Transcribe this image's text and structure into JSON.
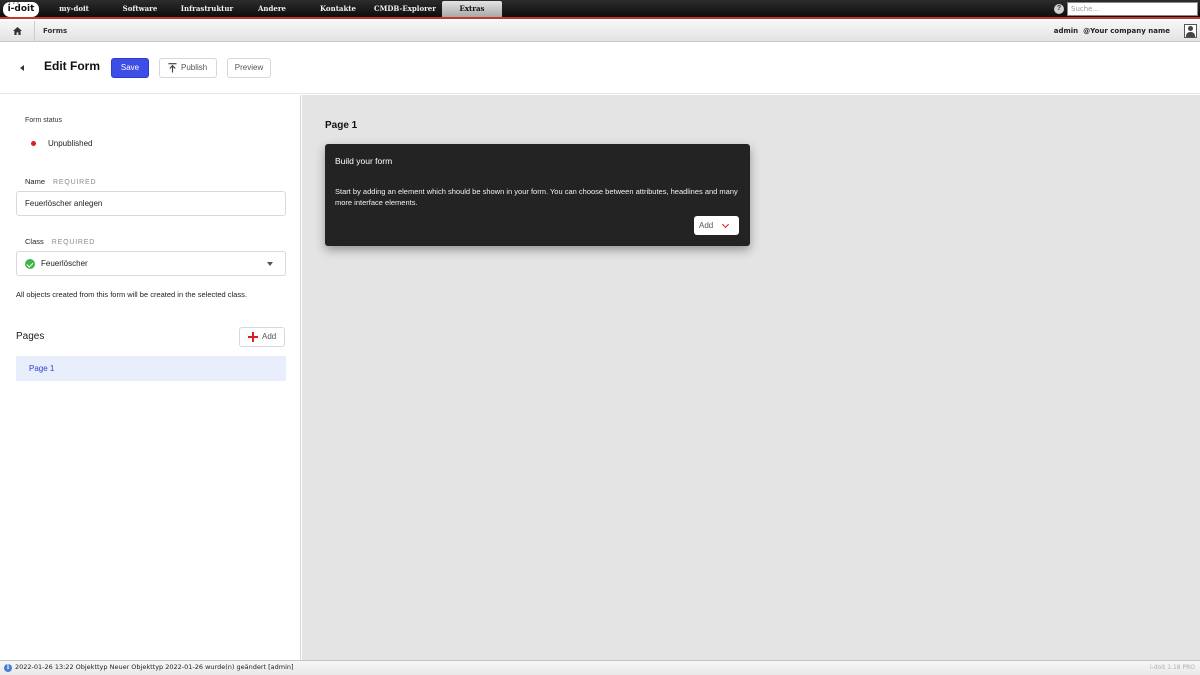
{
  "app": {
    "logo": "i-doit"
  },
  "nav": {
    "items": [
      {
        "label": "my-doit"
      },
      {
        "label": "Software"
      },
      {
        "label": "Infrastruktur"
      },
      {
        "label": "Andere"
      },
      {
        "label": "Kontakte"
      },
      {
        "label": "CMDB-Explorer"
      },
      {
        "label": "Extras"
      }
    ],
    "active": "Extras",
    "search_placeholder": "Suche..."
  },
  "breadcrumb": {
    "current": "Forms"
  },
  "user": {
    "name": "admin",
    "company": "@Your company name"
  },
  "header": {
    "title": "Edit Form",
    "save_label": "Save",
    "publish_label": "Publish",
    "preview_label": "Preview"
  },
  "form": {
    "status_label": "Form status",
    "status_value": "Unpublished",
    "status_color": "#d81e1e",
    "name_label": "Name",
    "required_text": "REQUIRED",
    "name_value": "Feuerlöscher anlegen",
    "class_label": "Class",
    "class_value": "Feuerlöscher",
    "class_help": "All objects created from this form will be created in the selected class."
  },
  "pages": {
    "title": "Pages",
    "add_label": "Add",
    "items": [
      {
        "label": "Page 1"
      }
    ]
  },
  "canvas": {
    "page_title": "Page 1",
    "card_title": "Build your form",
    "card_text": "Start by adding an element which should be shown in your form. You can choose between attributes, headlines and many more interface elements.",
    "add_label": "Add"
  },
  "statusbar": {
    "message": "2022-01-26 13:22 Objekttyp Neuer Objekttyp 2022-01-26 wurde(n) geändert [admin]",
    "version": "i-doit 1.18 PRO"
  },
  "colors": {
    "primary": "#3d4ee6",
    "accent": "#d81e1e",
    "success": "#3db649"
  }
}
